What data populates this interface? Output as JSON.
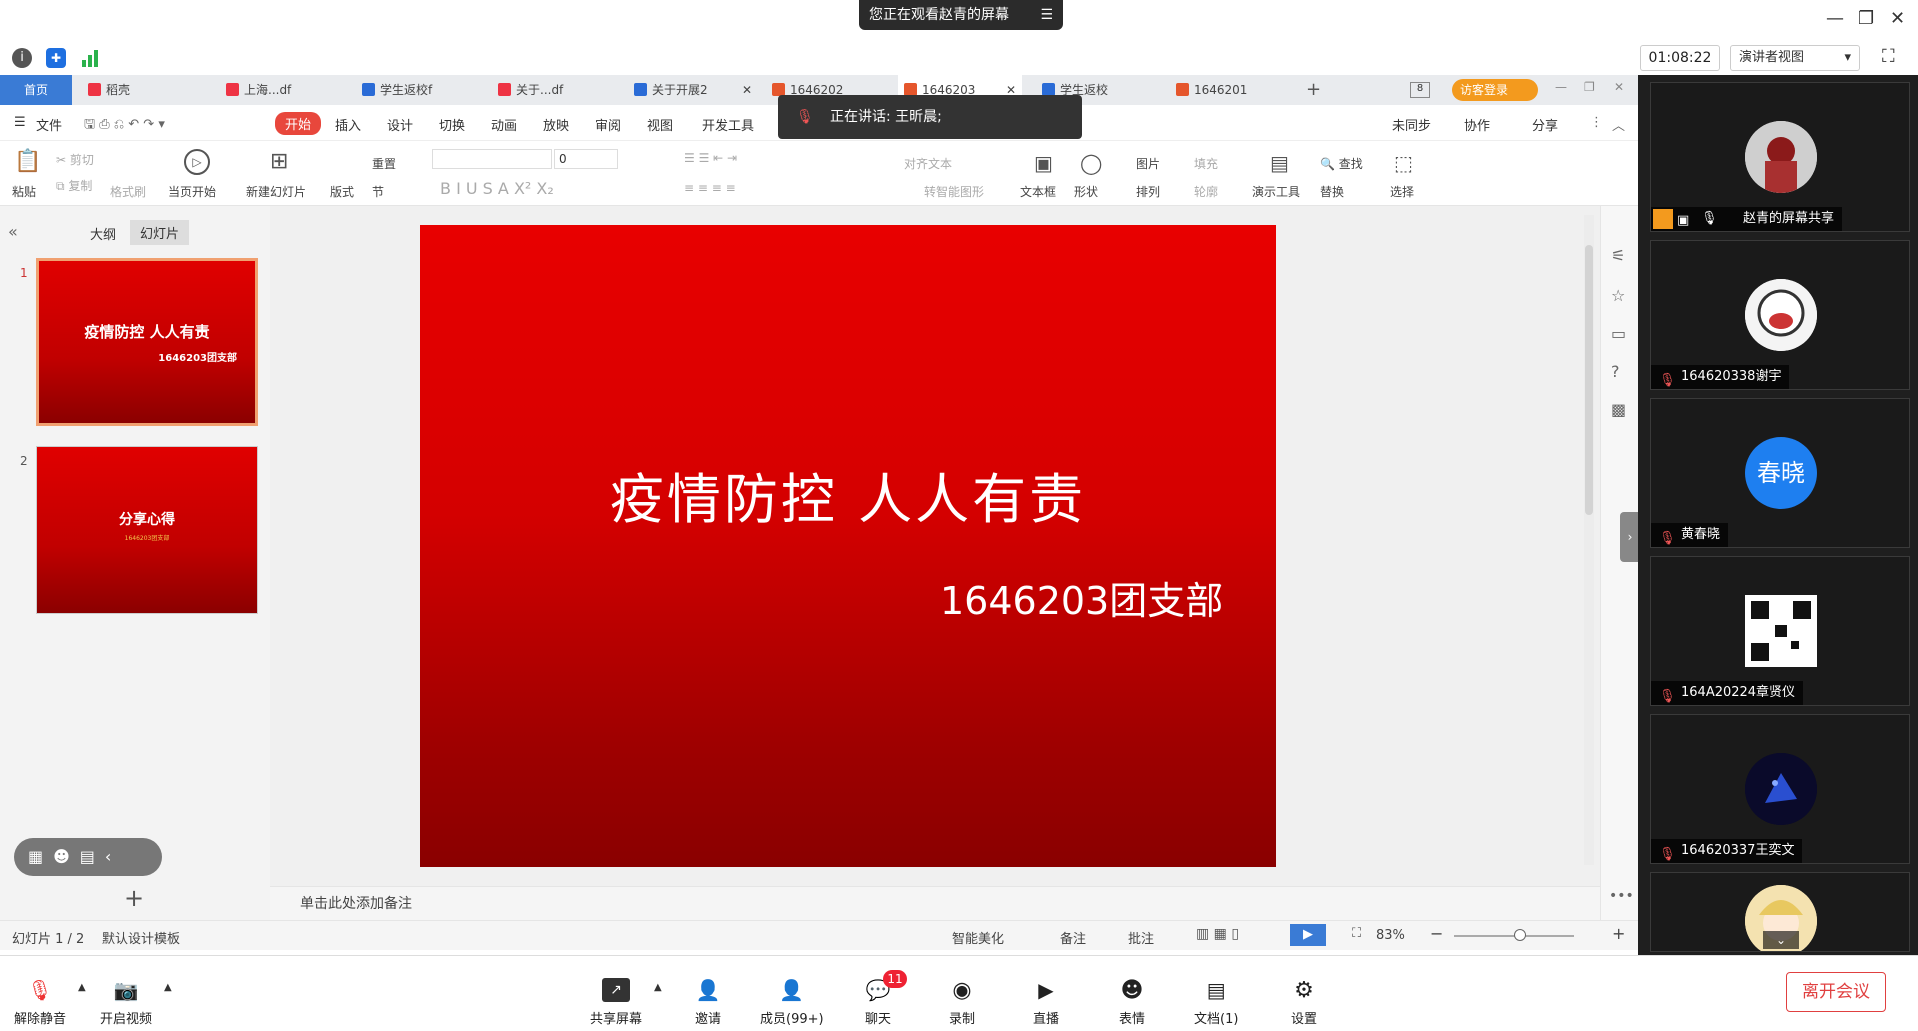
{
  "meeting": {
    "watch_banner": "您正在观看赵青的屏幕",
    "timer": "01:08:22",
    "presenter_view": "演讲者视图",
    "speaking": "正在讲话: 王昕晨;"
  },
  "wps": {
    "tabs": [
      {
        "label": "首页"
      },
      {
        "label": "稻壳"
      },
      {
        "label": "上海...df"
      },
      {
        "label": "学生返校f"
      },
      {
        "label": "关于...df"
      },
      {
        "label": "关于开展2"
      },
      {
        "label": "1646202"
      },
      {
        "label": "1646203"
      },
      {
        "label": "学生返校"
      },
      {
        "label": "1646201"
      }
    ],
    "login_label": "访客登录",
    "menu": [
      "文件",
      "开始",
      "插入",
      "设计",
      "切换",
      "动画",
      "放映",
      "审阅",
      "视图",
      "开发工具"
    ],
    "menu_right": [
      "未同步",
      "协作",
      "分享"
    ],
    "ribbon": {
      "paste": "粘贴",
      "cut": "剪切",
      "copy": "复制",
      "format_painter": "格式刷",
      "from_current": "当页开始",
      "new_slide": "新建幻灯片",
      "layout": "版式",
      "section": "节",
      "reset": "重置",
      "font_size": "0",
      "align_text": "对齐文本",
      "smart_shape": "转智能图形",
      "textbox": "文本框",
      "shape": "形状",
      "picture": "图片",
      "fill": "填充",
      "arrange": "排列",
      "outline": "轮廓",
      "present_tools": "演示工具",
      "find": "查找",
      "replace": "替换",
      "select": "选择"
    },
    "panel_tabs": [
      "大纲",
      "幻灯片"
    ],
    "thumbs": [
      {
        "num": "1",
        "title": "疫情防控  人人有责",
        "sub": "1646203团支部"
      },
      {
        "num": "2",
        "title": "分享心得",
        "sub": "1646203团支部"
      }
    ],
    "slide": {
      "title": "疫情防控  人人有责",
      "subtitle": "1646203团支部"
    },
    "notes_placeholder": "单击此处添加备注",
    "status": {
      "slide_count": "幻灯片 1 / 2",
      "template": "默认设计模板",
      "beautify": "智能美化",
      "notes": "备注",
      "comments": "批注",
      "zoom": "83%"
    }
  },
  "participants": [
    {
      "name": "赵青的屏幕共享"
    },
    {
      "name": "164620338谢宇"
    },
    {
      "name": "黄春晓",
      "avatar_text": "春晓"
    },
    {
      "name": "164A20224章贤仪"
    },
    {
      "name": "164620337王奕文"
    },
    {
      "name": ""
    }
  ],
  "toolbar": {
    "unmute": "解除静音",
    "start_video": "开启视频",
    "share_screen": "共享屏幕",
    "invite": "邀请",
    "members": "成员(99+)",
    "chat": "聊天",
    "chat_badge": "11",
    "record": "录制",
    "live": "直播",
    "emoji": "表情",
    "docs": "文档(1)",
    "settings": "设置",
    "leave": "离开会议"
  },
  "colors": {
    "slide_red": "#e00000",
    "accent_blue": "#3a7bd5",
    "leave_red": "#e04040"
  }
}
